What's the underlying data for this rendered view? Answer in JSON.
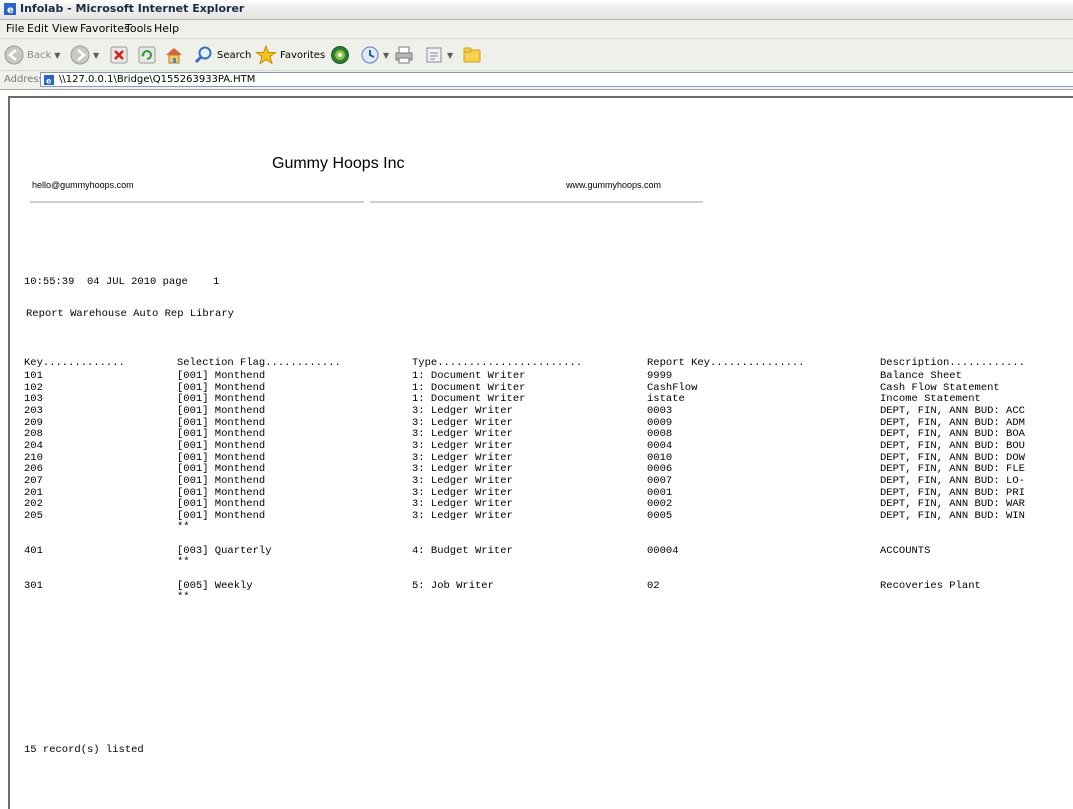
{
  "window": {
    "title": "Infolab - Microsoft Internet Explorer"
  },
  "menu": [
    "File",
    "Edit",
    "View",
    "Favorites",
    "Tools",
    "Help"
  ],
  "toolbar": {
    "back_label": "Back",
    "search_label": "Search",
    "favorites_label": "Favorites"
  },
  "address": {
    "label": "Address",
    "url": "\\\\127.0.0.1\\Bridge\\Q155263933PA.HTM"
  },
  "page": {
    "company": "Gummy Hoops Inc",
    "email": "hello@gummyhoops.com",
    "website": "www.gummyhoops.com",
    "timestamp_line": "10:55:39  04 JUL 2010 page    1",
    "report_title": "Report Warehouse Auto Rep Library",
    "columns": [
      "Key.............",
      "Selection Flag............",
      "Type.......................",
      "Report Key...............",
      "Description............"
    ],
    "rows": [
      {
        "key": "101",
        "flag": "[001] Monthend",
        "type": "1: Document Writer",
        "report_key": "9999",
        "description": "Balance Sheet"
      },
      {
        "key": "102",
        "flag": "[001] Monthend",
        "type": "1: Document Writer",
        "report_key": "CashFlow",
        "description": "Cash Flow Statement"
      },
      {
        "key": "103",
        "flag": "[001] Monthend",
        "type": "1: Document Writer",
        "report_key": "istate",
        "description": "Income Statement"
      },
      {
        "key": "203",
        "flag": "[001] Monthend",
        "type": "3: Ledger Writer",
        "report_key": "0003",
        "description": "DEPT, FIN, ANN BUD: ACC"
      },
      {
        "key": "209",
        "flag": "[001] Monthend",
        "type": "3: Ledger Writer",
        "report_key": "0009",
        "description": "DEPT, FIN, ANN BUD: ADM"
      },
      {
        "key": "208",
        "flag": "[001] Monthend",
        "type": "3: Ledger Writer",
        "report_key": "0008",
        "description": "DEPT, FIN, ANN BUD: BOA"
      },
      {
        "key": "204",
        "flag": "[001] Monthend",
        "type": "3: Ledger Writer",
        "report_key": "0004",
        "description": "DEPT, FIN, ANN BUD: BOU"
      },
      {
        "key": "210",
        "flag": "[001] Monthend",
        "type": "3: Ledger Writer",
        "report_key": "0010",
        "description": "DEPT, FIN, ANN BUD: DOW"
      },
      {
        "key": "206",
        "flag": "[001] Monthend",
        "type": "3: Ledger Writer",
        "report_key": "0006",
        "description": "DEPT, FIN, ANN BUD: FLE"
      },
      {
        "key": "207",
        "flag": "[001] Monthend",
        "type": "3: Ledger Writer",
        "report_key": "0007",
        "description": "DEPT, FIN, ANN BUD: LO-"
      },
      {
        "key": "201",
        "flag": "[001] Monthend",
        "type": "3: Ledger Writer",
        "report_key": "0001",
        "description": "DEPT, FIN, ANN BUD: PRI"
      },
      {
        "key": "202",
        "flag": "[001] Monthend",
        "type": "3: Ledger Writer",
        "report_key": "0002",
        "description": "DEPT, FIN, ANN BUD: WAR"
      },
      {
        "key": "205",
        "flag": "[001] Monthend",
        "type": "3: Ledger Writer",
        "report_key": "0005",
        "description": "DEPT, FIN, ANN BUD: WIN"
      },
      {
        "key": "",
        "flag": "**",
        "type": "",
        "report_key": "",
        "description": ""
      },
      {
        "key": "",
        "flag": "",
        "type": "",
        "report_key": "",
        "description": ""
      },
      {
        "key": "401",
        "flag": "[003] Quarterly",
        "type": "4: Budget Writer",
        "report_key": "00004",
        "description": "ACCOUNTS"
      },
      {
        "key": "",
        "flag": "**",
        "type": "",
        "report_key": "",
        "description": ""
      },
      {
        "key": "",
        "flag": "",
        "type": "",
        "report_key": "",
        "description": ""
      },
      {
        "key": "301",
        "flag": "[005] Weekly",
        "type": "5: Job Writer",
        "report_key": "02",
        "description": "Recoveries Plant"
      },
      {
        "key": "",
        "flag": "**",
        "type": "",
        "report_key": "",
        "description": ""
      }
    ],
    "footer": "15 record(s) listed"
  }
}
